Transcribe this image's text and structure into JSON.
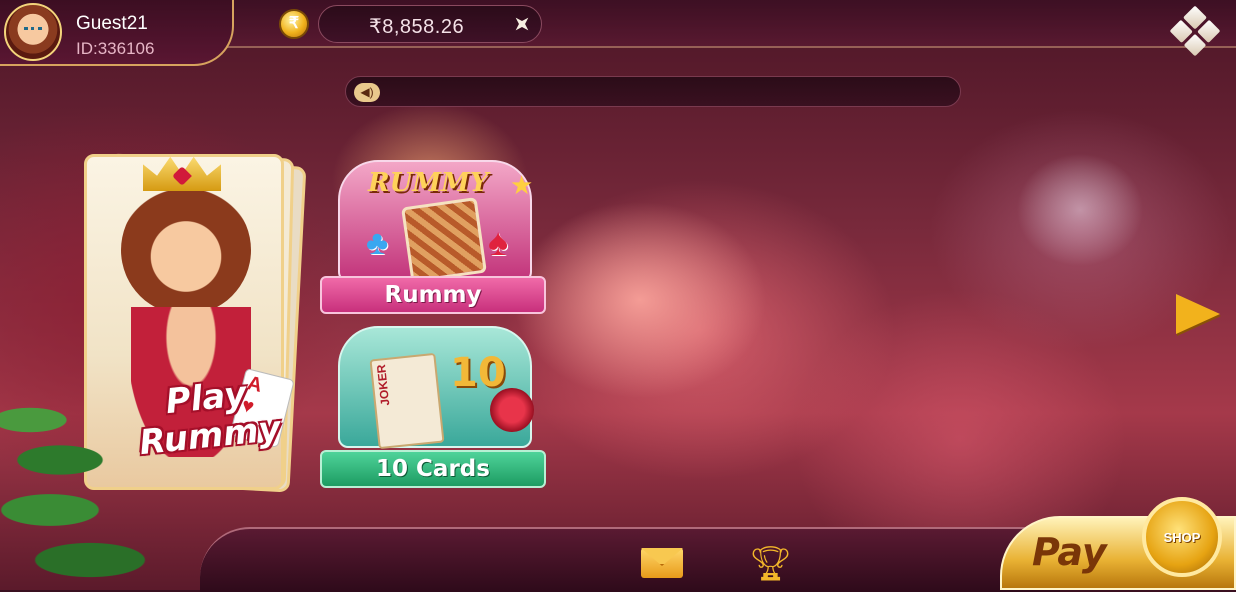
{
  "profile": {
    "username": "Guest21",
    "user_id": "ID:336106",
    "avatar_icon": "queen-avatar-icon"
  },
  "wallet": {
    "coin_icon": "rupee-coin-icon",
    "balance": "₹8,858.26",
    "add_icon": "add-sparkle-icon"
  },
  "menu": {
    "icon": "diamond-grid-icon"
  },
  "announcement": {
    "icon": "speaker-icon",
    "text": ""
  },
  "hero": {
    "title_line1": "Play",
    "title_line2": "Rummy",
    "ace_label": "A"
  },
  "games": [
    {
      "logo": "RUMMY",
      "label": "Rummy",
      "accent": "#c8307c"
    },
    {
      "logo": "JOKER",
      "label": "10 Cards",
      "ten": "10",
      "accent": "#1d9c62"
    }
  ],
  "bottom_nav": {
    "mail_icon": "mail-icon",
    "trophy_icon": "trophy-icon",
    "pay_label": "Pay",
    "shop_label": "SHOP"
  },
  "colors": {
    "gold": "#f2b21c",
    "bar_bg": "#3a1020"
  }
}
